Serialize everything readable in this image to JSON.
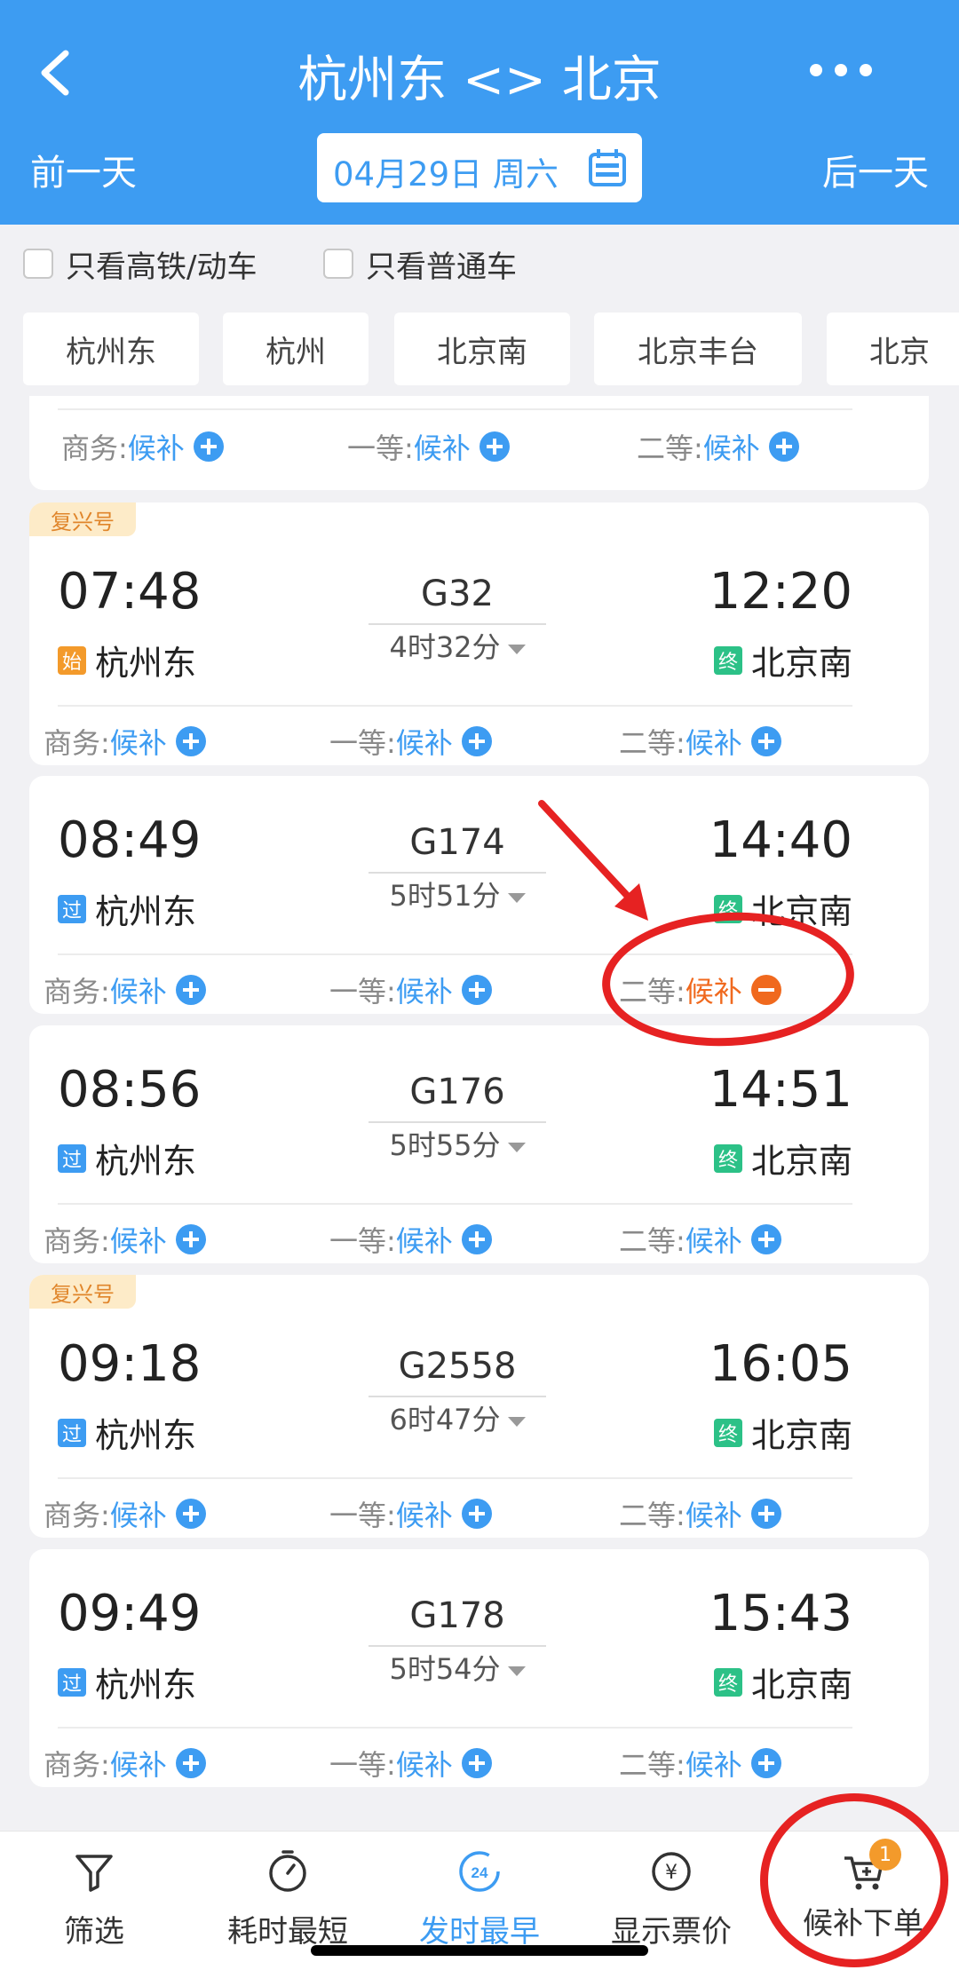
{
  "header": {
    "title": "杭州东 <> 北京",
    "prev_day": "前一天",
    "next_day": "后一天",
    "date": "04月29日 周六"
  },
  "filters": {
    "hs_label": "只看高铁/动车",
    "normal_label": "只看普通车"
  },
  "stations": [
    "杭州东",
    "杭州",
    "北京南",
    "北京丰台",
    "北京"
  ],
  "seat_labels": {
    "business": "商务:",
    "first": "一等:",
    "second": "二等:"
  },
  "partial_card": {
    "business_status": "候补",
    "first_status": "候补",
    "second_status": "候补"
  },
  "trains": [
    {
      "badge": "复兴号",
      "dep_time": "07:48",
      "arr_time": "12:20",
      "train_no": "G32",
      "duration": "4时32分",
      "dep_tag": "始",
      "dep_station": "杭州东",
      "arr_tag": "终",
      "arr_station": "北京南",
      "business_status": "候补",
      "first_status": "候补",
      "second_status": "候补"
    },
    {
      "badge": "",
      "dep_time": "08:49",
      "arr_time": "14:40",
      "train_no": "G174",
      "duration": "5时51分",
      "dep_tag": "过",
      "dep_station": "杭州东",
      "arr_tag": "终",
      "arr_station": "北京南",
      "business_status": "候补",
      "first_status": "候补",
      "second_status": "候补"
    },
    {
      "badge": "",
      "dep_time": "08:56",
      "arr_time": "14:51",
      "train_no": "G176",
      "duration": "5时55分",
      "dep_tag": "过",
      "dep_station": "杭州东",
      "arr_tag": "终",
      "arr_station": "北京南",
      "business_status": "候补",
      "first_status": "候补",
      "second_status": "候补"
    },
    {
      "badge": "复兴号",
      "dep_time": "09:18",
      "arr_time": "16:05",
      "train_no": "G2558",
      "duration": "6时47分",
      "dep_tag": "过",
      "dep_station": "杭州东",
      "arr_tag": "终",
      "arr_station": "北京南",
      "business_status": "候补",
      "first_status": "候补",
      "second_status": "候补"
    },
    {
      "badge": "",
      "dep_time": "09:49",
      "arr_time": "15:43",
      "train_no": "G178",
      "duration": "5时54分",
      "dep_tag": "过",
      "dep_station": "杭州东",
      "arr_tag": "终",
      "arr_station": "北京南",
      "business_status": "候补",
      "first_status": "候补",
      "second_status": "候补"
    }
  ],
  "bottom_tabs": {
    "filter": "筛选",
    "shortest": "耗时最短",
    "earliest": "发时最早",
    "earliest_icon_text": "24",
    "price": "显示票价",
    "price_icon_text": "¥",
    "waitlist": "候补下单",
    "waitlist_count": "1"
  },
  "colors": {
    "primary": "#3d9cf2",
    "accent_orange": "#f0691e",
    "annotation_red": "#e62222"
  }
}
